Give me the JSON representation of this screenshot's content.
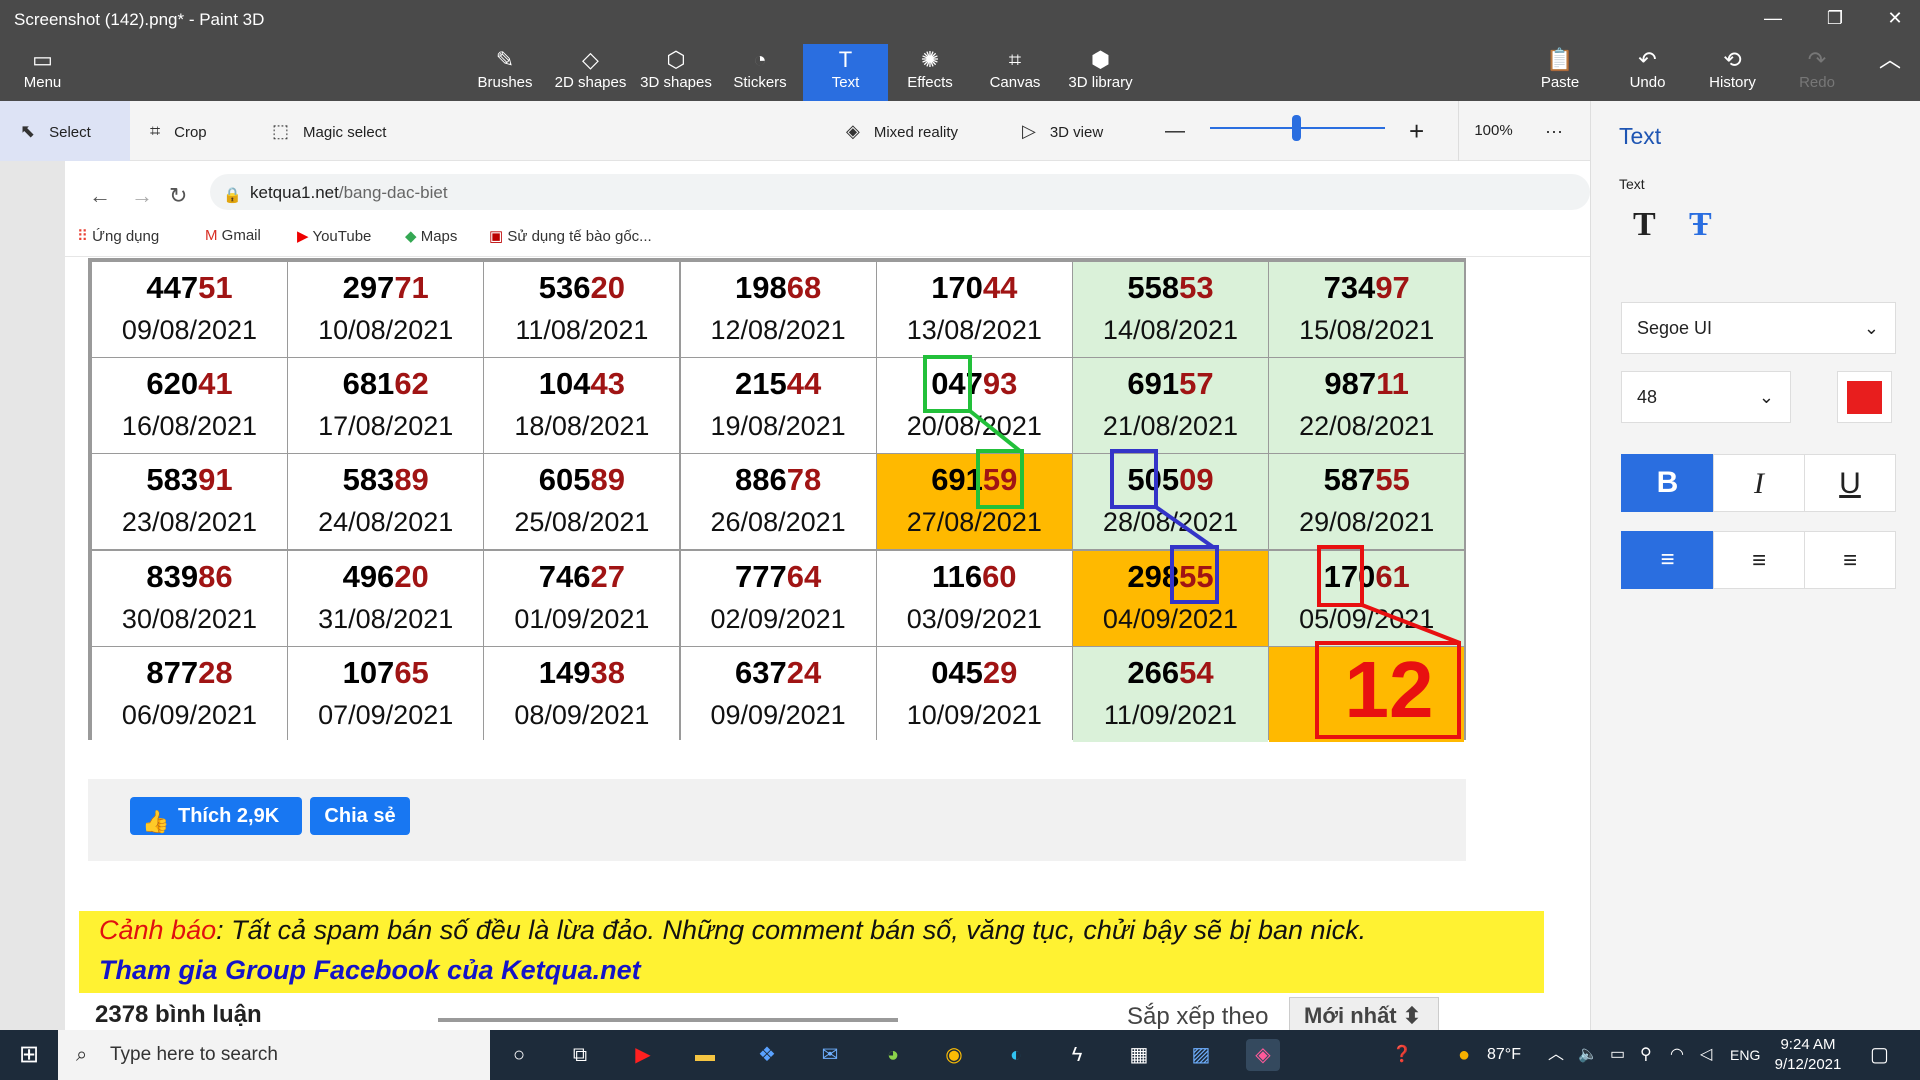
{
  "window": {
    "title": "Screenshot (142).png* - Paint 3D",
    "minimize": "—",
    "maximize": "❐",
    "close": "✕"
  },
  "ribbon": {
    "menu": "Menu",
    "tools": [
      "Brushes",
      "2D shapes",
      "3D shapes",
      "Stickers",
      "Text",
      "Effects",
      "Canvas",
      "3D library"
    ],
    "selected_tool": "Text",
    "paste": "Paste",
    "undo": "Undo",
    "history": "History",
    "redo": "Redo"
  },
  "toolbar": {
    "select": "Select",
    "crop": "Crop",
    "magic_select": "Magic select",
    "mixed_reality": "Mixed reality",
    "view_3d": "3D view",
    "zoom_minus": "—",
    "zoom_plus": "+",
    "zoom": "100%",
    "more": "···",
    "zoom_slider_fraction": 0.42
  },
  "panel": {
    "title": "Text",
    "text_label": "Text",
    "font": "Segoe UI",
    "size": "48",
    "text_color": "#e81e1e",
    "bold": "B",
    "italic": "I",
    "underline": "U",
    "bold_active": true,
    "align_left_active": true
  },
  "browser": {
    "url_domain": "ketqua1.net",
    "url_path": "/bang-dac-biet",
    "bookmarks": [
      "Ứng dụng",
      "Gmail",
      "YouTube",
      "Maps",
      "Sử dụng tế bào gốc..."
    ]
  },
  "table": {
    "rows": [
      [
        {
          "a": "447",
          "b": "51",
          "d": "09/08/2021",
          "bg": "white"
        },
        {
          "a": "297",
          "b": "71",
          "d": "10/08/2021",
          "bg": "white"
        },
        {
          "a": "536",
          "b": "20",
          "d": "11/08/2021",
          "bg": "white"
        },
        {
          "a": "198",
          "b": "68",
          "d": "12/08/2021",
          "bg": "white"
        },
        {
          "a": "170",
          "b": "44",
          "d": "13/08/2021",
          "bg": "white"
        },
        {
          "a": "558",
          "b": "53",
          "d": "14/08/2021",
          "bg": "green"
        },
        {
          "a": "734",
          "b": "97",
          "d": "15/08/2021",
          "bg": "green"
        }
      ],
      [
        {
          "a": "620",
          "b": "41",
          "d": "16/08/2021",
          "bg": "white"
        },
        {
          "a": "681",
          "b": "62",
          "d": "17/08/2021",
          "bg": "white"
        },
        {
          "a": "104",
          "b": "43",
          "d": "18/08/2021",
          "bg": "white"
        },
        {
          "a": "215",
          "b": "44",
          "d": "19/08/2021",
          "bg": "white"
        },
        {
          "a": "047",
          "b": "93",
          "d": "20/08/2021",
          "bg": "white"
        },
        {
          "a": "691",
          "b": "57",
          "d": "21/08/2021",
          "bg": "green"
        },
        {
          "a": "987",
          "b": "11",
          "d": "22/08/2021",
          "bg": "green"
        }
      ],
      [
        {
          "a": "583",
          "b": "91",
          "d": "23/08/2021",
          "bg": "white"
        },
        {
          "a": "583",
          "b": "89",
          "d": "24/08/2021",
          "bg": "white"
        },
        {
          "a": "605",
          "b": "89",
          "d": "25/08/2021",
          "bg": "white"
        },
        {
          "a": "886",
          "b": "78",
          "d": "26/08/2021",
          "bg": "white"
        },
        {
          "a": "691",
          "b": "59",
          "d": "27/08/2021",
          "bg": "orange"
        },
        {
          "a": "505",
          "b": "09",
          "d": "28/08/2021",
          "bg": "green"
        },
        {
          "a": "587",
          "b": "55",
          "d": "29/08/2021",
          "bg": "green"
        }
      ],
      [
        {
          "a": "839",
          "b": "86",
          "d": "30/08/2021",
          "bg": "white"
        },
        {
          "a": "496",
          "b": "20",
          "d": "31/08/2021",
          "bg": "white"
        },
        {
          "a": "746",
          "b": "27",
          "d": "01/09/2021",
          "bg": "white"
        },
        {
          "a": "777",
          "b": "64",
          "d": "02/09/2021",
          "bg": "white"
        },
        {
          "a": "116",
          "b": "60",
          "d": "03/09/2021",
          "bg": "white"
        },
        {
          "a": "298",
          "b": "55",
          "d": "04/09/2021",
          "bg": "orange"
        },
        {
          "a": "170",
          "b": "61",
          "d": "05/09/2021",
          "bg": "green"
        }
      ],
      [
        {
          "a": "877",
          "b": "28",
          "d": "06/09/2021",
          "bg": "white"
        },
        {
          "a": "107",
          "b": "65",
          "d": "07/09/2021",
          "bg": "white"
        },
        {
          "a": "149",
          "b": "38",
          "d": "08/09/2021",
          "bg": "white"
        },
        {
          "a": "637",
          "b": "24",
          "d": "09/09/2021",
          "bg": "white"
        },
        {
          "a": "045",
          "b": "29",
          "d": "10/09/2021",
          "bg": "white"
        },
        {
          "a": "266",
          "b": "54",
          "d": "11/09/2021",
          "bg": "green"
        },
        {
          "a": "",
          "b": "",
          "d": "",
          "bg": "orange"
        }
      ]
    ],
    "annotation_text": "12",
    "annotation_colors": {
      "green": "#22c03a",
      "blue": "#3434c8",
      "red": "#e81010"
    }
  },
  "share": {
    "like_label": "Thích 2,9K",
    "share_label": "Chia sẻ"
  },
  "warning": {
    "prefix": "Cảnh báo",
    "text": ": Tất cả spam bán số đều là lừa đảo. Những comment bán số, văng tục, chửi bậy sẽ bị ban nick.",
    "link": "Tham gia Group Facebook của Ketqua.net"
  },
  "comments": {
    "count": "2378 bình luận",
    "sort_label": "Sắp xếp theo",
    "sort_value": "Mới nhất ⬍"
  },
  "taskbar": {
    "search_placeholder": "Type here to search",
    "temp": "87°F",
    "lang": "ENG",
    "time": "9:24 AM",
    "date": "9/12/2021"
  }
}
